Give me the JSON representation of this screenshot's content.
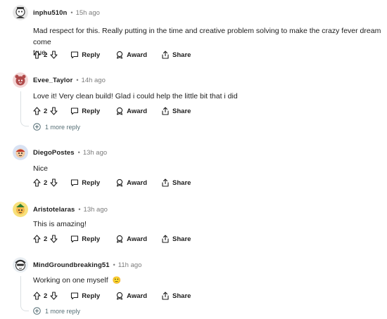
{
  "comments": [
    {
      "username": "inphu510n",
      "separator": "•",
      "timestamp": "15h ago",
      "text_line1": "Mad respect for this. Really putting in the time and creative problem solving to make the crazy fever dream come",
      "text_line2": "true.",
      "votes": "2",
      "reply_label": "Reply",
      "award_label": "Award",
      "share_label": "Share",
      "avatar_colors": {
        "bg": "#e8e8e8",
        "fg": "#3b3b3b"
      }
    },
    {
      "username": "Evee_Taylor",
      "separator": "•",
      "timestamp": "14h ago",
      "text": "Love it! Very clean build! Glad i could help the little bit that i did",
      "votes": "2",
      "reply_label": "Reply",
      "award_label": "Award",
      "share_label": "Share",
      "more_replies": "1 more reply",
      "avatar_colors": {
        "bg": "#f3d6d6",
        "fg": "#b04a4a"
      }
    },
    {
      "username": "DiegoPostes",
      "separator": "•",
      "timestamp": "13h ago",
      "text": "Nice",
      "votes": "2",
      "reply_label": "Reply",
      "award_label": "Award",
      "share_label": "Share",
      "avatar_colors": {
        "bg": "#d9e2f3",
        "fg": "#c0392b"
      }
    },
    {
      "username": "Aristotelaras",
      "separator": "•",
      "timestamp": "13h ago",
      "text": "This is amazing!",
      "votes": "2",
      "reply_label": "Reply",
      "award_label": "Award",
      "share_label": "Share",
      "avatar_colors": {
        "bg": "#f7e07a",
        "fg": "#2e7d32"
      }
    },
    {
      "username": "MindGroundbreaking51",
      "separator": "•",
      "timestamp": "11h ago",
      "text": "Working on one myself",
      "emoji": "🙂",
      "votes": "2",
      "reply_label": "Reply",
      "award_label": "Award",
      "share_label": "Share",
      "more_replies": "1 more reply",
      "avatar_colors": {
        "bg": "#e9eef2",
        "fg": "#2b2b2b"
      }
    }
  ],
  "icons": {
    "upvote": "upvote-icon",
    "downvote": "downvote-icon",
    "reply": "reply-icon",
    "award": "award-icon",
    "share": "share-icon",
    "more": "plus-circle-icon"
  },
  "colors": {
    "text": "#1c1c1c",
    "meta": "#7c7c7c",
    "link": "#576f76",
    "thread_line": "#dbe0e3"
  }
}
